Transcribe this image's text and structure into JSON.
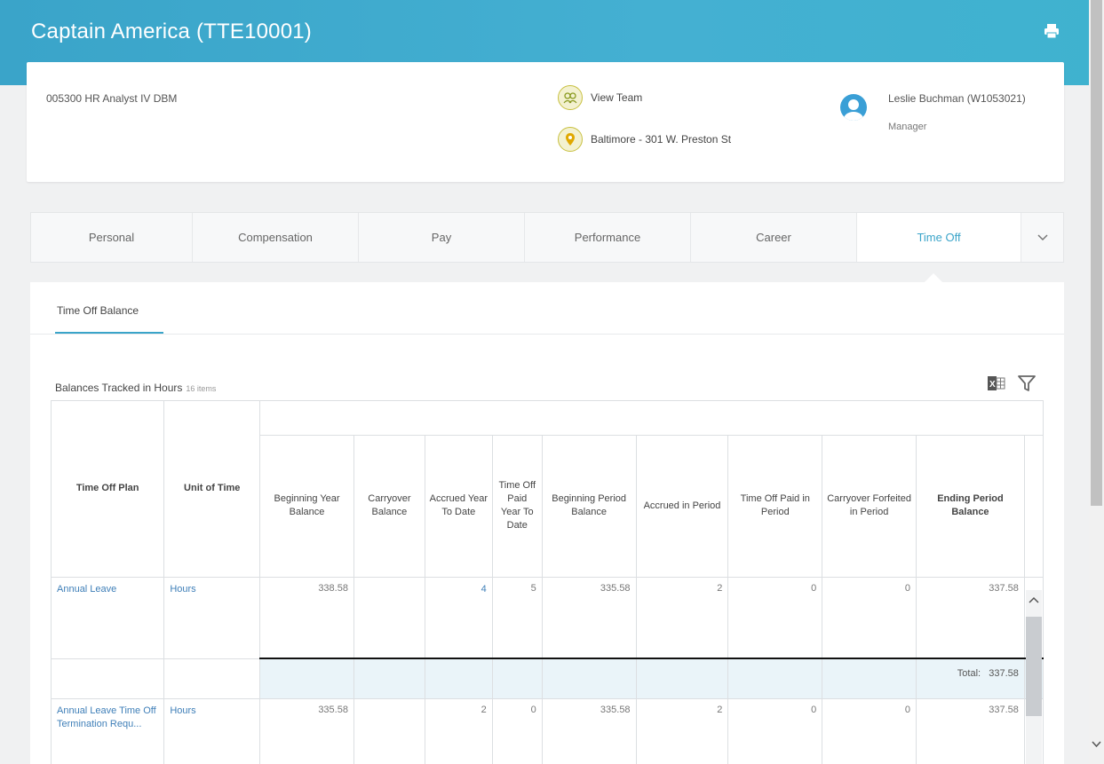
{
  "header": {
    "title": "Captain America (TTE10001)",
    "print_icon": "printer-icon"
  },
  "profile": {
    "position": "005300 HR Analyst IV DBM",
    "view_team": "View Team",
    "location": "Baltimore - 301 W. Preston St",
    "manager_name": "Leslie Buchman (W1053021)",
    "manager_role": "Manager"
  },
  "tabs": [
    {
      "label": "Personal",
      "active": false
    },
    {
      "label": "Compensation",
      "active": false
    },
    {
      "label": "Pay",
      "active": false
    },
    {
      "label": "Performance",
      "active": false
    },
    {
      "label": "Career",
      "active": false
    },
    {
      "label": "Time Off",
      "active": true
    }
  ],
  "subtab": "Time Off Balance",
  "grid": {
    "title": "Balances Tracked in Hours",
    "count": "16 items",
    "columns": [
      "Time Off Plan",
      "Unit of Time",
      "Beginning Year Balance",
      "Carryover Balance",
      "Accrued Year To Date",
      "Time Off Paid Year To Date",
      "Beginning Period Balance",
      "Accrued in Period",
      "Time Off Paid in Period",
      "Carryover Forfeited in Period",
      "Ending Period Balance"
    ],
    "rows": [
      {
        "plan": "Annual Leave",
        "unit": "Hours",
        "beginning_year_balance": "338.58",
        "carryover_balance": "",
        "accrued_ytd": "4",
        "paid_ytd": "5",
        "beginning_period_balance": "335.58",
        "accrued_in_period": "2",
        "paid_in_period": "0",
        "carryover_forfeited": "0",
        "ending_period_balance": "337.58"
      },
      {
        "plan": "Annual Leave Time Off Termination Requ...",
        "unit": "Hours",
        "beginning_year_balance": "335.58",
        "carryover_balance": "",
        "accrued_ytd": "2",
        "paid_ytd": "0",
        "beginning_period_balance": "335.58",
        "accrued_in_period": "2",
        "paid_in_period": "0",
        "carryover_forfeited": "0",
        "ending_period_balance": "337.58"
      }
    ],
    "total_label": "Total:",
    "total_value": "337.58"
  }
}
